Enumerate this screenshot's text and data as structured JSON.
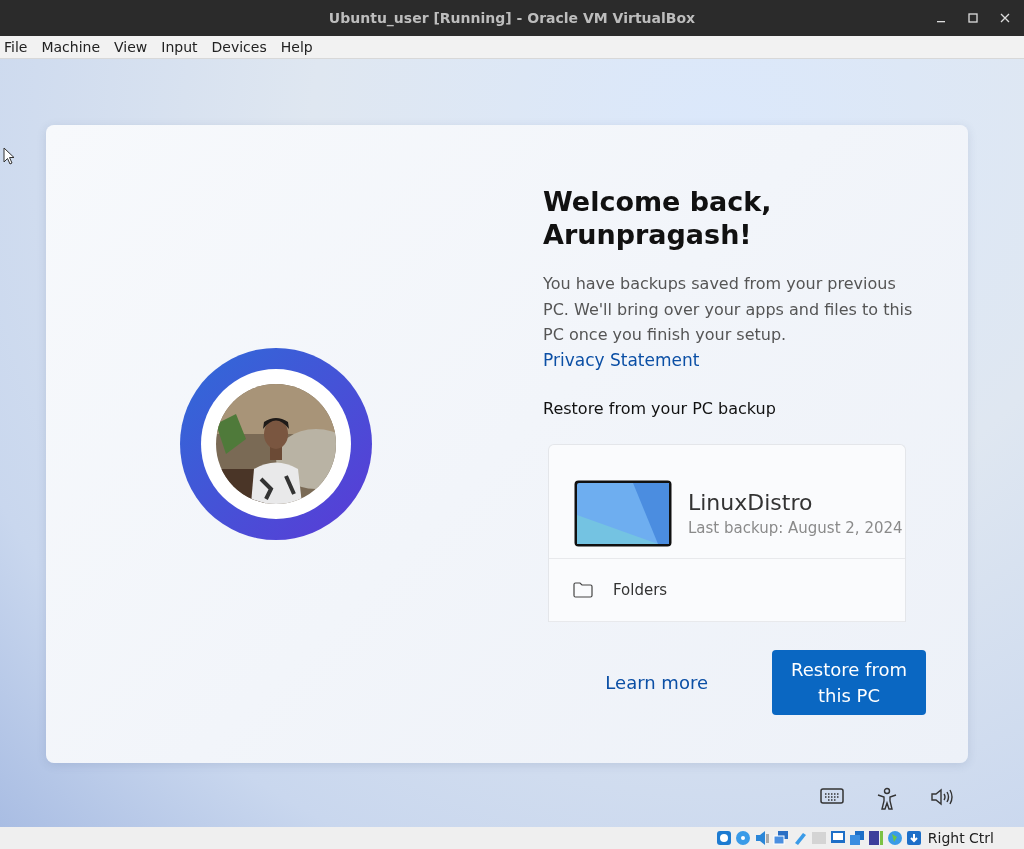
{
  "window": {
    "title": "Ubuntu_user [Running] - Oracle VM VirtualBox"
  },
  "menu": [
    "File",
    "Machine",
    "View",
    "Input",
    "Devices",
    "Help"
  ],
  "welcome": {
    "title": "Welcome back, Arunpragash!",
    "body": "You have backups saved from your previous PC. We'll bring over your apps and files to this PC once you finish your setup.",
    "link": "Privacy Statement",
    "section": "Restore from your PC backup"
  },
  "backup": {
    "name": "LinuxDistro",
    "date": "Last backup: August 2, 2024",
    "items": [
      "Folders"
    ]
  },
  "actions": {
    "secondary": "Learn more",
    "primary": "Restore from this PC"
  },
  "status_bar": {
    "host_key": "Right Ctrl"
  }
}
